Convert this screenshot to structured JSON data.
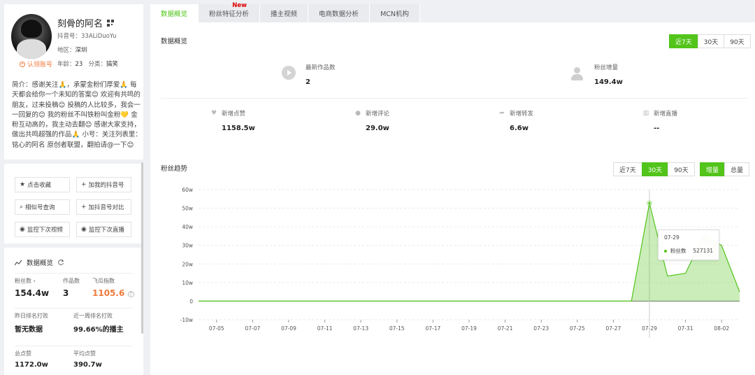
{
  "profile": {
    "name": "刻骨的阿名",
    "douyin_id": "抖音号：33ALiDuoYu",
    "region_label": "地区：",
    "region": "深圳",
    "age_label": "年龄：",
    "age": "23",
    "category_label": "分类：",
    "category": "搞笑",
    "verified": "认领账号",
    "bio": "简介：感谢关注🙏，承蒙金粉们厚爱🙏 每天都会给你一个未知的答案😊 欢迎有共鸣的朋友，过来投稿😊 投稿的人比较多，我会一一回复的😊 我的粉丝不叫铁粉叫金粉💛 金粉互动高的，我主动去翻😊 感谢大家支持，做出共鸣超强的作品🙏 小号：关注列表里：铭心的阿名 原创者联盟，翻拍请@一下😊"
  },
  "sidebar_buttons": [
    {
      "icon": "★",
      "label": "点击收藏"
    },
    {
      "icon": "+",
      "label": "加我的抖音号"
    },
    {
      "icon": "⌕",
      "label": "相似号查询"
    },
    {
      "icon": "+",
      "label": "加抖音号对比"
    },
    {
      "icon": "◉",
      "label": "监控下次视频"
    },
    {
      "icon": "◉",
      "label": "监控下次直播"
    }
  ],
  "sidebar_overview": {
    "title": "数据概览",
    "fans_label": "粉丝数 ›",
    "fans": "154.4w",
    "works_label": "作品数",
    "works": "3",
    "index_label": "飞瓜指数",
    "index": "1105.6",
    "yesterday_rank_label": "昨日排名打败",
    "yesterday_rank": "暂无数据",
    "week_rank_label": "近一周排名打败",
    "week_rank": "99.66%的播主",
    "total_likes_label": "总点赞",
    "total_likes": "1172.0w",
    "avg_likes_label": "平均点赞",
    "avg_likes": "390.7w"
  },
  "tabs": [
    {
      "label": "数据概览",
      "active": true
    },
    {
      "label": "粉丝特征分析",
      "badge": "New"
    },
    {
      "label": "播主视频"
    },
    {
      "label": "电商数据分析"
    },
    {
      "label": "MCN机构"
    }
  ],
  "overview": {
    "title": "数据概览",
    "ranges": [
      "近7天",
      "30天",
      "90天"
    ],
    "active_range": "近7天",
    "latest_works_label": "最新作品数",
    "latest_works": "2",
    "fans_growth_label": "粉丝增量",
    "fans_growth": "149.4w",
    "small": [
      {
        "icon": "♥",
        "label": "新增点赞",
        "value": "1158.5w"
      },
      {
        "icon": "●",
        "label": "新增评论",
        "value": "29.0w"
      },
      {
        "icon": "➦",
        "label": "新增转发",
        "value": "6.6w"
      },
      {
        "icon": "▥",
        "label": "新增直播",
        "value": "--"
      }
    ]
  },
  "trend": {
    "title": "粉丝趋势",
    "ranges": [
      "近7天",
      "30天",
      "90天"
    ],
    "active_range": "30天",
    "modes": [
      "增量",
      "总量"
    ],
    "active_mode": "增量",
    "tooltip": {
      "date": "07-29",
      "series": "粉丝数",
      "value": "527131"
    }
  },
  "chart_data": {
    "type": "area",
    "title": "",
    "xlabel": "",
    "ylabel": "",
    "ylim": [
      -10,
      60
    ],
    "y_ticks": [
      "-10w",
      "0",
      "10w",
      "20w",
      "30w",
      "40w",
      "50w",
      "60w"
    ],
    "y_tick_values": [
      -10,
      0,
      10,
      20,
      30,
      40,
      50,
      60
    ],
    "x_tick_labels": [
      "07-05",
      "07-07",
      "07-09",
      "07-11",
      "07-13",
      "07-15",
      "07-17",
      "07-19",
      "07-21",
      "07-23",
      "07-25",
      "07-27",
      "07-29",
      "07-31",
      "08-02"
    ],
    "x": [
      "07-04",
      "07-05",
      "07-06",
      "07-07",
      "07-08",
      "07-09",
      "07-10",
      "07-11",
      "07-12",
      "07-13",
      "07-14",
      "07-15",
      "07-16",
      "07-17",
      "07-18",
      "07-19",
      "07-20",
      "07-21",
      "07-22",
      "07-23",
      "07-24",
      "07-25",
      "07-26",
      "07-27",
      "07-28",
      "07-29",
      "07-30",
      "07-31",
      "08-01",
      "08-02",
      "08-03"
    ],
    "series": [
      {
        "values": [
          0,
          0,
          0,
          0,
          0,
          0,
          0,
          0,
          0,
          0,
          0,
          0,
          0,
          0,
          0,
          0,
          0,
          0,
          0,
          0,
          0,
          0,
          0,
          0,
          0,
          52.7,
          13.5,
          15,
          35,
          30,
          5
        ],
        "color": "#52c41a"
      }
    ],
    "highlight_index": 25,
    "grid": true
  }
}
